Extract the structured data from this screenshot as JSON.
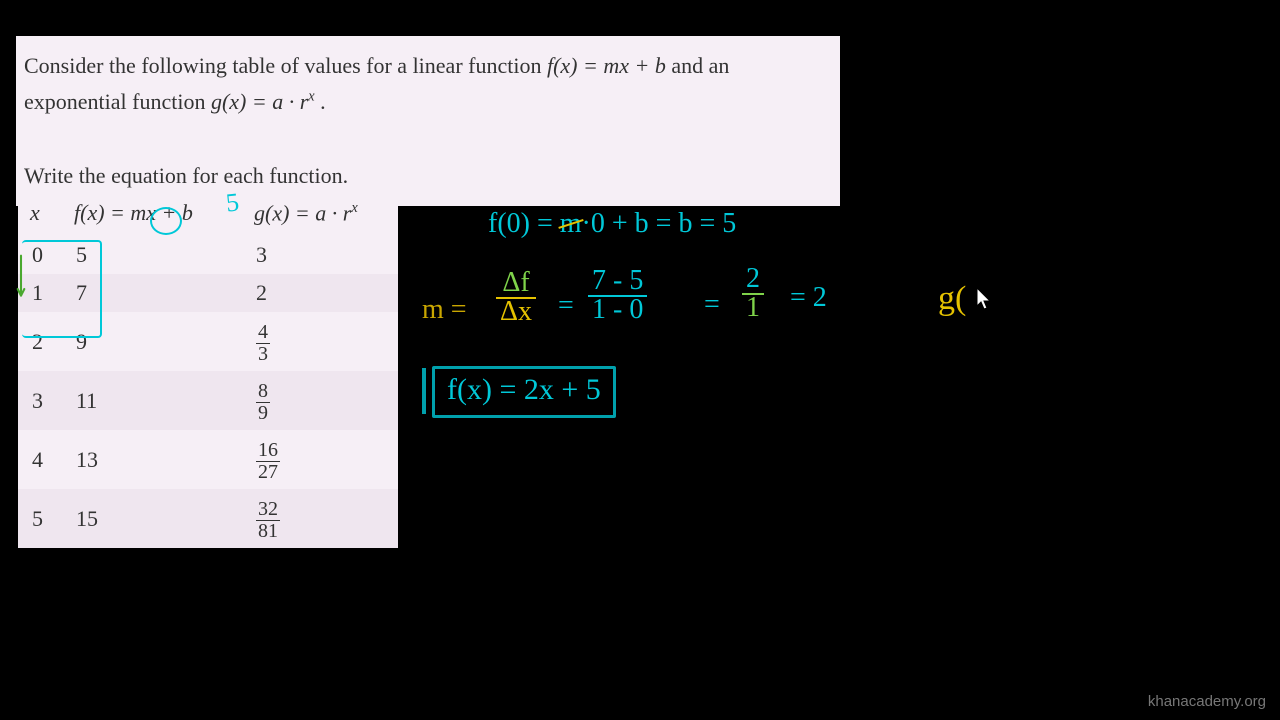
{
  "problem": {
    "line1_a": "Consider the following table of values for a linear function ",
    "line1_b": "f(x) = mx + b",
    "line1_c": " and an",
    "line2_a": "exponential function ",
    "line2_b": "g(x) = a · r",
    "line2_b_sup": "x",
    "line2_c": " .",
    "line3": "Write the equation for each function."
  },
  "table": {
    "head_x": "x",
    "head_f_a": "f(x) = ",
    "head_f_m": "m",
    "head_f_b": "x + b",
    "head_g_a": "g(x) = a · r",
    "head_g_sup": "x",
    "rows": [
      {
        "x": "0",
        "f": "5",
        "g_num": "3",
        "g_den": ""
      },
      {
        "x": "1",
        "f": "7",
        "g_num": "2",
        "g_den": ""
      },
      {
        "x": "2",
        "f": "9",
        "g_num": "4",
        "g_den": "3"
      },
      {
        "x": "3",
        "f": "11",
        "g_num": "8",
        "g_den": "9"
      },
      {
        "x": "4",
        "f": "13",
        "g_num": "16",
        "g_den": "27"
      },
      {
        "x": "5",
        "f": "15",
        "g_num": "32",
        "g_den": "81"
      }
    ]
  },
  "annotation_five": "5",
  "work": {
    "eq1_a": "f(0) = ",
    "eq1_m": "m",
    "eq1_b": "·0 + b  = b = 5",
    "eq2_m": "m = ",
    "eq2_f1_n": "Δf",
    "eq2_f1_d": "Δx",
    "eq2_eq1": "=",
    "eq2_f2_n": "7 - 5",
    "eq2_f2_d": "1 - 0",
    "eq2_eq2": "=",
    "eq2_f3_n": "2",
    "eq2_f3_d": "1",
    "eq2_eq3": "= 2",
    "eq3": "f(x) = 2x + 5",
    "g_partial": "g("
  },
  "watermark": "khanacademy.org"
}
